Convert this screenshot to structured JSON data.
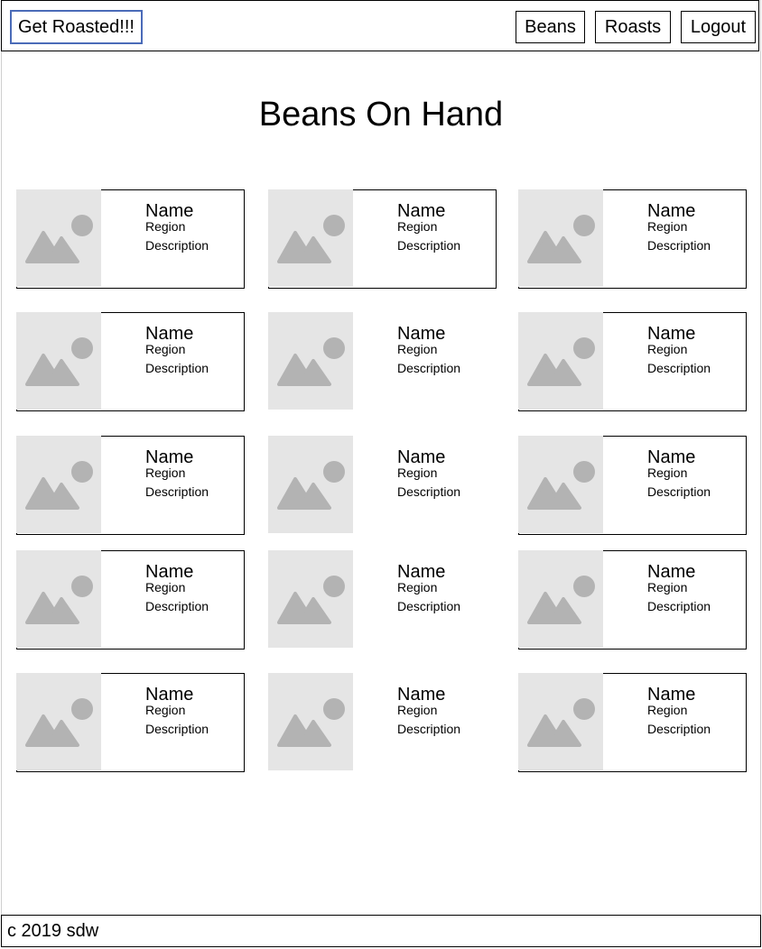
{
  "navbar": {
    "brand": "Get Roasted!!!",
    "links": [
      {
        "label": "Beans"
      },
      {
        "label": "Roasts"
      },
      {
        "label": "Logout"
      }
    ]
  },
  "page": {
    "title": "Beans On Hand"
  },
  "cards": [
    {
      "name": "Name",
      "region": "Region",
      "description": "Description",
      "image_icon": "image-placeholder-icon",
      "bordered": true
    },
    {
      "name": "Name",
      "region": "Region",
      "description": "Description",
      "image_icon": "image-placeholder-icon",
      "bordered": true
    },
    {
      "name": "Name",
      "region": "Region",
      "description": "Description",
      "image_icon": "image-placeholder-icon",
      "bordered": true
    },
    {
      "name": "Name",
      "region": "Region",
      "description": "Description",
      "image_icon": "image-placeholder-icon",
      "bordered": true
    },
    {
      "name": "Name",
      "region": "Region",
      "description": "Description",
      "image_icon": "image-placeholder-icon",
      "bordered": false
    },
    {
      "name": "Name",
      "region": "Region",
      "description": "Description",
      "image_icon": "image-placeholder-icon",
      "bordered": true
    },
    {
      "name": "Name",
      "region": "Region",
      "description": "Description",
      "image_icon": "image-placeholder-icon",
      "bordered": true
    },
    {
      "name": "Name",
      "region": "Region",
      "description": "Description",
      "image_icon": "image-placeholder-icon",
      "bordered": false
    },
    {
      "name": "Name",
      "region": "Region",
      "description": "Description",
      "image_icon": "image-placeholder-icon",
      "bordered": true
    },
    {
      "name": "Name",
      "region": "Region",
      "description": "Description",
      "image_icon": "image-placeholder-icon",
      "bordered": true
    },
    {
      "name": "Name",
      "region": "Region",
      "description": "Description",
      "image_icon": "image-placeholder-icon",
      "bordered": false
    },
    {
      "name": "Name",
      "region": "Region",
      "description": "Description",
      "image_icon": "image-placeholder-icon",
      "bordered": true
    },
    {
      "name": "Name",
      "region": "Region",
      "description": "Description",
      "image_icon": "image-placeholder-icon",
      "bordered": true
    },
    {
      "name": "Name",
      "region": "Region",
      "description": "Description",
      "image_icon": "image-placeholder-icon",
      "bordered": false
    },
    {
      "name": "Name",
      "region": "Region",
      "description": "Description",
      "image_icon": "image-placeholder-icon",
      "bordered": true
    }
  ],
  "footer": {
    "text": "c 2019 sdw"
  },
  "colors": {
    "brand_border": "#4a6bb8",
    "placeholder_bg": "#e5e5e5",
    "placeholder_icon": "#b3b3b3"
  }
}
